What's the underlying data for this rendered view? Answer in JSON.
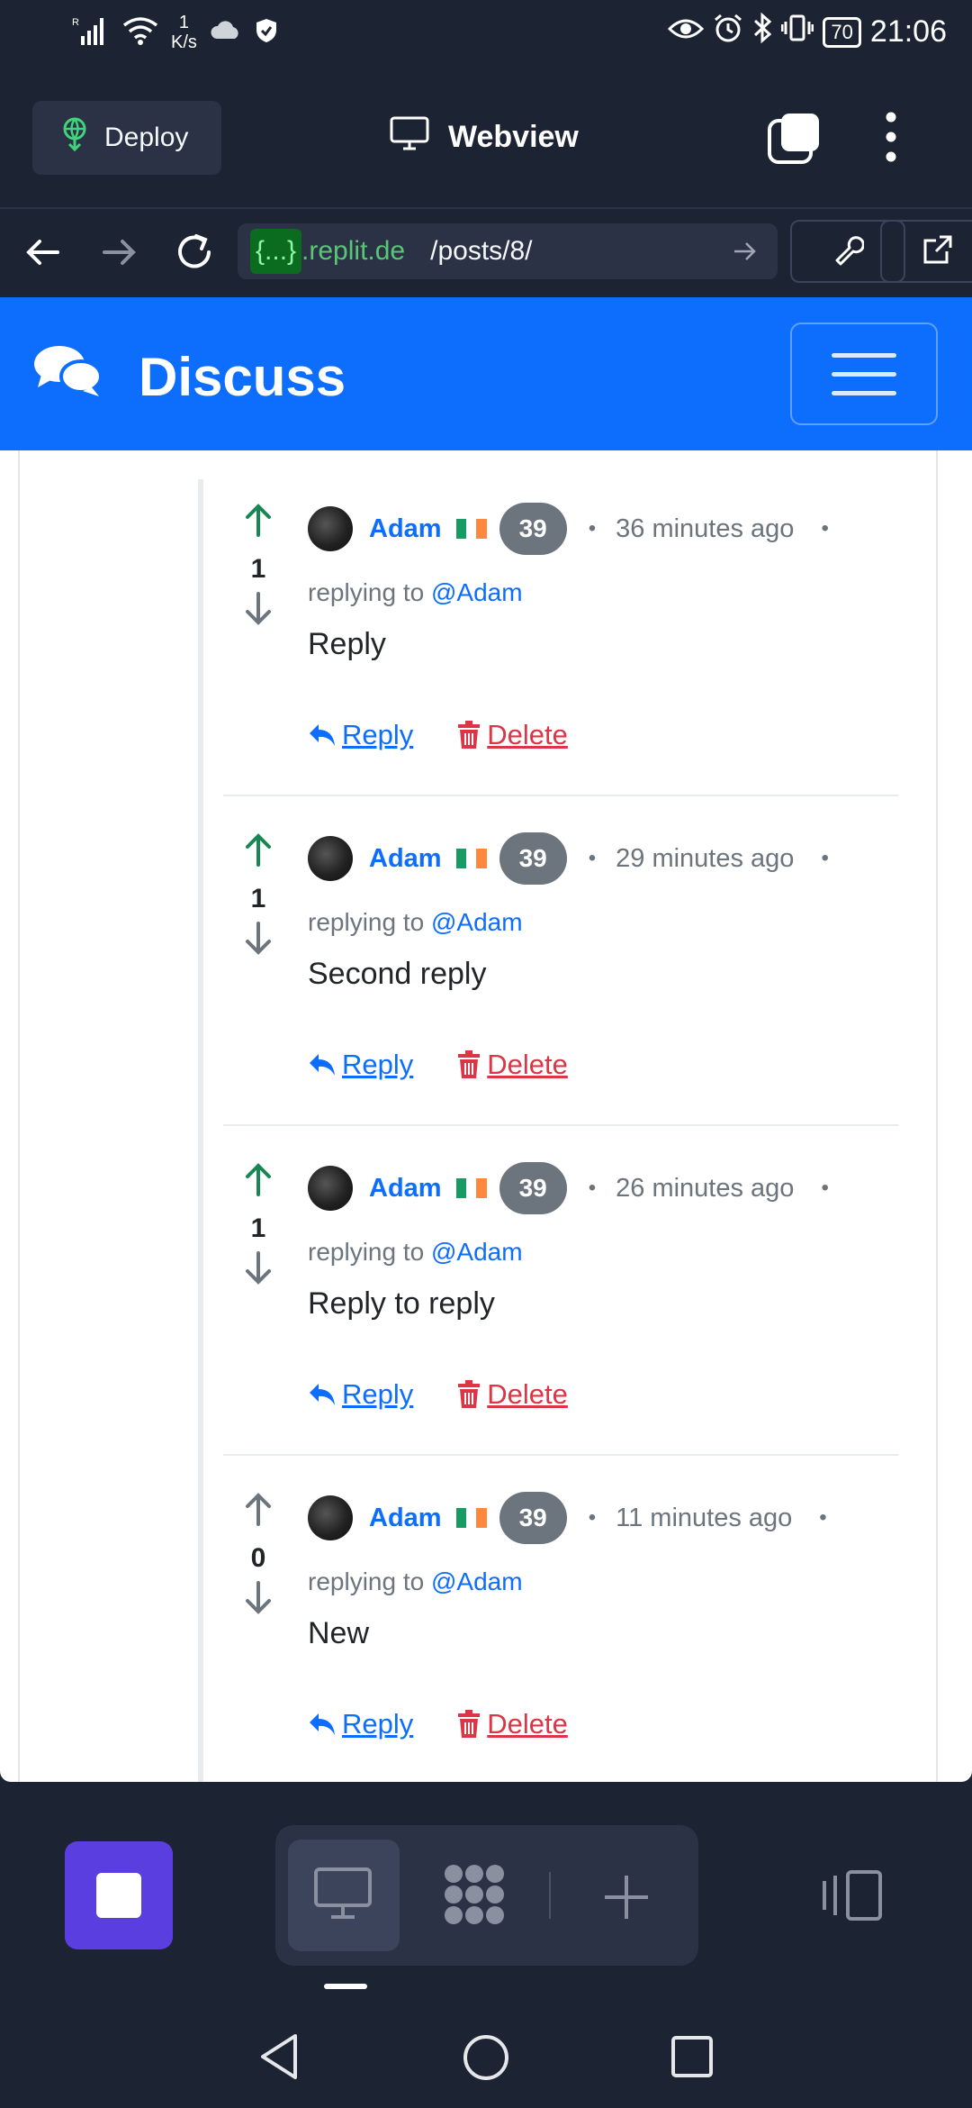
{
  "status_bar": {
    "network": "R",
    "speed_value": "1",
    "speed_unit": "K/s",
    "battery": "70",
    "time": "21:06"
  },
  "topbar": {
    "deploy_label": "Deploy",
    "title": "Webview"
  },
  "url": {
    "host_placeholder": "{...}",
    "domain": ".replit.de",
    "path": "/posts/8/"
  },
  "site": {
    "brand": "Discuss"
  },
  "comments": [
    {
      "author": "Adam",
      "score": "39",
      "time": "36 minutes ago",
      "replying_prefix": "replying to",
      "replying_to": "@Adam",
      "votes": "1",
      "upvoted": true,
      "body": "Reply",
      "reply_label": "Reply",
      "delete_label": "Delete"
    },
    {
      "author": "Adam",
      "score": "39",
      "time": "29 minutes ago",
      "replying_prefix": "replying to",
      "replying_to": "@Adam",
      "votes": "1",
      "upvoted": true,
      "body": "Second reply",
      "reply_label": "Reply",
      "delete_label": "Delete"
    },
    {
      "author": "Adam",
      "score": "39",
      "time": "26 minutes ago",
      "replying_prefix": "replying to",
      "replying_to": "@Adam",
      "votes": "1",
      "upvoted": true,
      "body": "Reply to reply",
      "reply_label": "Reply",
      "delete_label": "Delete"
    },
    {
      "author": "Adam",
      "score": "39",
      "time": "11 minutes ago",
      "replying_prefix": "replying to",
      "replying_to": "@Adam",
      "votes": "0",
      "upvoted": false,
      "body": "New",
      "reply_label": "Reply",
      "delete_label": "Delete"
    }
  ],
  "colors": {
    "navbar": "#0d6efd",
    "upvote_active": "#198754",
    "vote_inactive": "#6c757d",
    "delete": "#dc3545",
    "stop_button": "#5b3ee0"
  }
}
